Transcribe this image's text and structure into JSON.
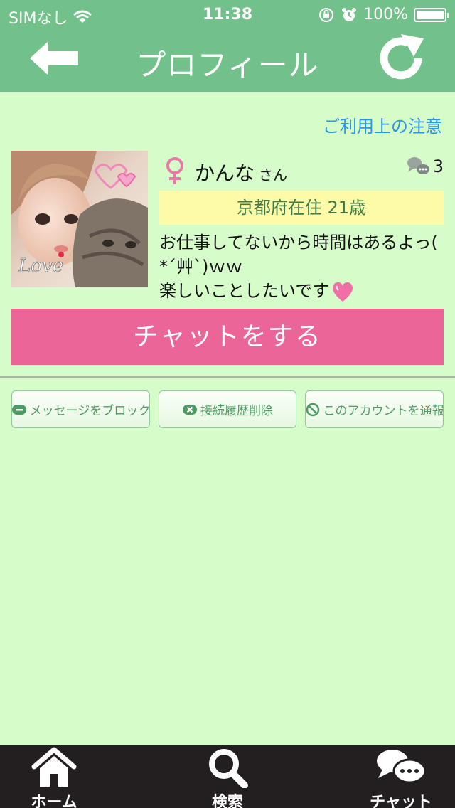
{
  "status_bar": {
    "carrier": "SIMなし",
    "time": "11:38",
    "battery": "100%",
    "icons": [
      "wifi-icon",
      "orientation-lock-icon",
      "alarm-icon",
      "battery-icon"
    ]
  },
  "nav": {
    "title": "プロフィール",
    "back_icon": "arrow-left-icon",
    "refresh_icon": "refresh-icon"
  },
  "notice_link": "ご利用上の注意",
  "profile": {
    "gender_icon": "female-symbol-icon",
    "name": "かんな",
    "honorific": "さん",
    "comment_count": "3",
    "location_age": "京都府在住 21歳",
    "bio": "お仕事してないから時間はあるよっ( *´艸`)ｗｗ\n楽しいことしたいです"
  },
  "chat_button": "チャットをする",
  "actions": {
    "block": "メッセージをブロック",
    "delete_history": "接続履歴削除",
    "report": "このアカウントを通報"
  },
  "tabs": {
    "home": "ホーム",
    "search": "検索",
    "chat": "チャット"
  },
  "colors": {
    "header": "#72c08a",
    "background": "#d6fcca",
    "chat_button": "#ec6598",
    "location_band": "#fefba8",
    "link": "#2a96e8",
    "tab_bar": "#231f20"
  }
}
